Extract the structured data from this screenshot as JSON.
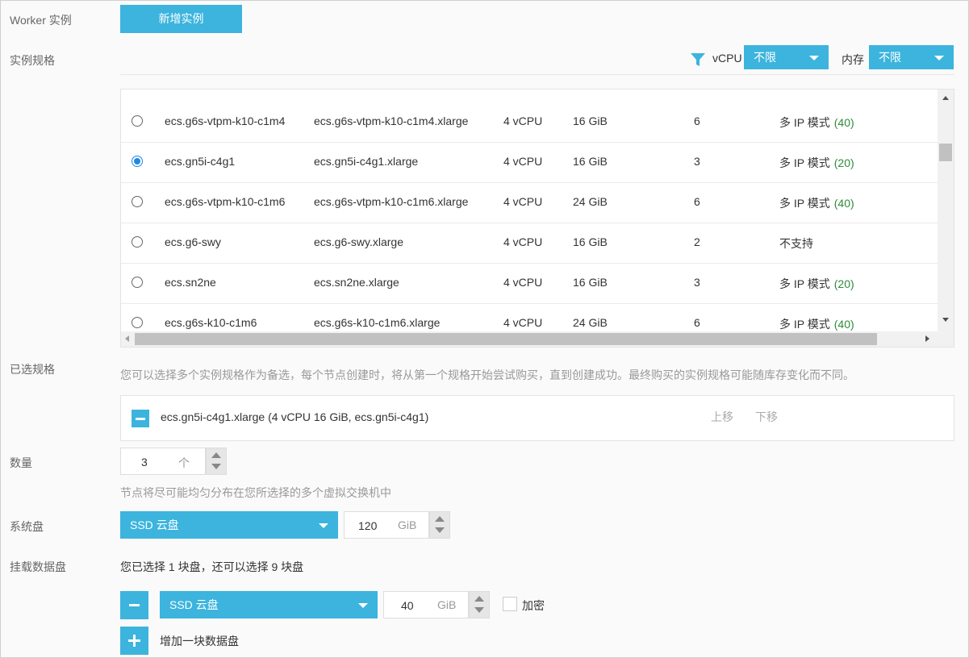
{
  "worker": {
    "label": "Worker 实例",
    "add_button": "新增实例"
  },
  "spec": {
    "label": "实例规格",
    "filter": {
      "vcpu_label": "vCPU",
      "vcpu_value": "不限",
      "mem_label": "内存",
      "mem_value": "不限"
    },
    "rows": [
      {
        "family": "ecs.g6s-vtpm-k10-c1m4",
        "type": "ecs.g6s-vtpm-k10-c1m4.xlarge",
        "vcpu": "4 vCPU",
        "mem": "16 GiB",
        "eni": "6",
        "ip_mode": "多 IP 模式",
        "ip_count": "(40)",
        "selected": false
      },
      {
        "family": "ecs.gn5i-c4g1",
        "type": "ecs.gn5i-c4g1.xlarge",
        "vcpu": "4 vCPU",
        "mem": "16 GiB",
        "eni": "3",
        "ip_mode": "多 IP 模式",
        "ip_count": "(20)",
        "selected": true
      },
      {
        "family": "ecs.g6s-vtpm-k10-c1m6",
        "type": "ecs.g6s-vtpm-k10-c1m6.xlarge",
        "vcpu": "4 vCPU",
        "mem": "24 GiB",
        "eni": "6",
        "ip_mode": "多 IP 模式",
        "ip_count": "(40)",
        "selected": false
      },
      {
        "family": "ecs.g6-swy",
        "type": "ecs.g6-swy.xlarge",
        "vcpu": "4 vCPU",
        "mem": "16 GiB",
        "eni": "2",
        "ip_mode": "不支持",
        "ip_count": "",
        "selected": false
      },
      {
        "family": "ecs.sn2ne",
        "type": "ecs.sn2ne.xlarge",
        "vcpu": "4 vCPU",
        "mem": "16 GiB",
        "eni": "3",
        "ip_mode": "多 IP 模式",
        "ip_count": "(20)",
        "selected": false
      },
      {
        "family": "ecs.g6s-k10-c1m6",
        "type": "ecs.g6s-k10-c1m6.xlarge",
        "vcpu": "4 vCPU",
        "mem": "24 GiB",
        "eni": "6",
        "ip_mode": "多 IP 模式",
        "ip_count": "(40)",
        "selected": false
      }
    ]
  },
  "selected_spec": {
    "label": "已选规格",
    "hint": "您可以选择多个实例规格作为备选，每个节点创建时，将从第一个规格开始尝试购买，直到创建成功。最终购买的实例规格可能随库存变化而不同。",
    "item": "ecs.gn5i-c4g1.xlarge (4 vCPU 16 GiB, ecs.gn5i-c4g1)",
    "move_up": "上移",
    "move_down": "下移"
  },
  "quantity": {
    "label": "数量",
    "value": "3",
    "unit": "个",
    "hint": "节点将尽可能均匀分布在您所选择的多个虚拟交换机中"
  },
  "system_disk": {
    "label": "系统盘",
    "type": "SSD 云盘",
    "size": "120",
    "unit": "GiB"
  },
  "data_disk": {
    "label": "挂载数据盘",
    "summary": "您已选择 1 块盘，还可以选择 9 块盘",
    "type": "SSD 云盘",
    "size": "40",
    "unit": "GiB",
    "encrypt_label": "加密",
    "add_label": "增加一块数据盘"
  },
  "colors": {
    "accent": "#3cb4dd",
    "radio": "#1e88e5",
    "count_green": "#2e8b3a"
  }
}
